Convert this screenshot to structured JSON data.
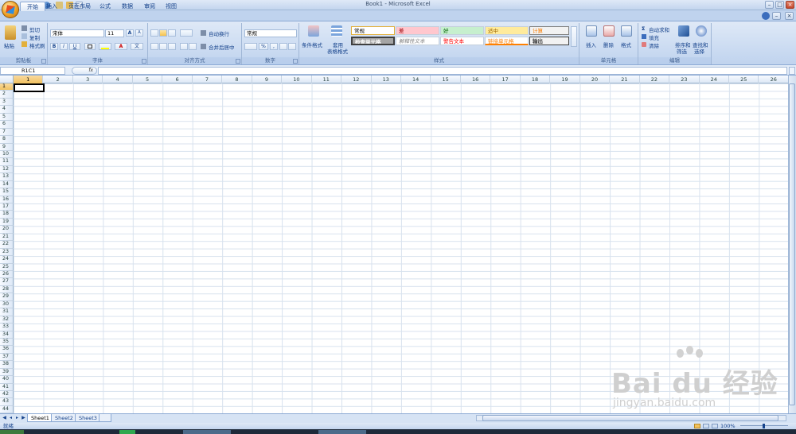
{
  "window": {
    "title": "Book1 - Microsoft Excel",
    "min": "–",
    "max": "□",
    "close": "×"
  },
  "tabs": [
    "开始",
    "插入",
    "页面布局",
    "公式",
    "数据",
    "审阅",
    "视图"
  ],
  "ribbon": {
    "clipboard": {
      "label": "剪贴板",
      "paste": "粘贴",
      "cut": "剪切",
      "copy": "复制",
      "format_painter": "格式刷"
    },
    "font": {
      "label": "字体",
      "name": "宋体",
      "size": "11",
      "bold": "B",
      "italic": "I",
      "underline": "U",
      "grow": "A",
      "shrink": "A",
      "font_color": "A",
      "phonetic": "文"
    },
    "alignment": {
      "label": "对齐方式",
      "wrap": "自动换行",
      "merge": "合并后居中"
    },
    "number": {
      "label": "数字",
      "format": "常规",
      "percent": "%",
      "comma": ","
    },
    "styles": {
      "label": "样式",
      "cond_format": "条件格式",
      "table_format_1": "套用",
      "table_format_2": "表格格式",
      "cells": [
        "常规",
        "差",
        "好",
        "适中",
        "计算",
        "检查单元格",
        "解释性文本",
        "警告文本",
        "链接单元格",
        "输出"
      ]
    },
    "cells": {
      "label": "单元格",
      "insert": "插入",
      "delete": "删除",
      "format": "格式"
    },
    "editing": {
      "label": "编辑",
      "autosum": "自动求和",
      "fill": "填充",
      "clear": "清除",
      "sort_1": "排序和",
      "sort_2": "筛选",
      "find_1": "查找和",
      "find_2": "选择"
    }
  },
  "formula_bar": {
    "name_box": "R1C1",
    "fx": "fx"
  },
  "columns": [
    "1",
    "2",
    "3",
    "4",
    "5",
    "6",
    "7",
    "8",
    "9",
    "10",
    "11",
    "12",
    "13",
    "14",
    "15",
    "16",
    "17",
    "18",
    "19",
    "20",
    "21",
    "22",
    "23",
    "24",
    "25",
    "26"
  ],
  "rows": [
    "1",
    "2",
    "3",
    "4",
    "5",
    "6",
    "7",
    "8",
    "9",
    "10",
    "11",
    "12",
    "13",
    "14",
    "15",
    "16",
    "17",
    "18",
    "19",
    "20",
    "21",
    "22",
    "23",
    "24",
    "25",
    "26",
    "27",
    "28",
    "29",
    "30",
    "31",
    "32",
    "33",
    "34",
    "35",
    "36",
    "37",
    "38",
    "39",
    "40",
    "41",
    "42",
    "43",
    "44"
  ],
  "sheets": [
    "Sheet1",
    "Sheet2",
    "Sheet3"
  ],
  "status": {
    "ready": "就绪",
    "zoom": "100%"
  },
  "watermark": {
    "brand": "Bai du 经验",
    "url": "jingyan.baidu.com"
  },
  "colors": {
    "accent": "#15428b",
    "ribbon": "#c9daf1",
    "selected_header": "#f1c15f"
  }
}
